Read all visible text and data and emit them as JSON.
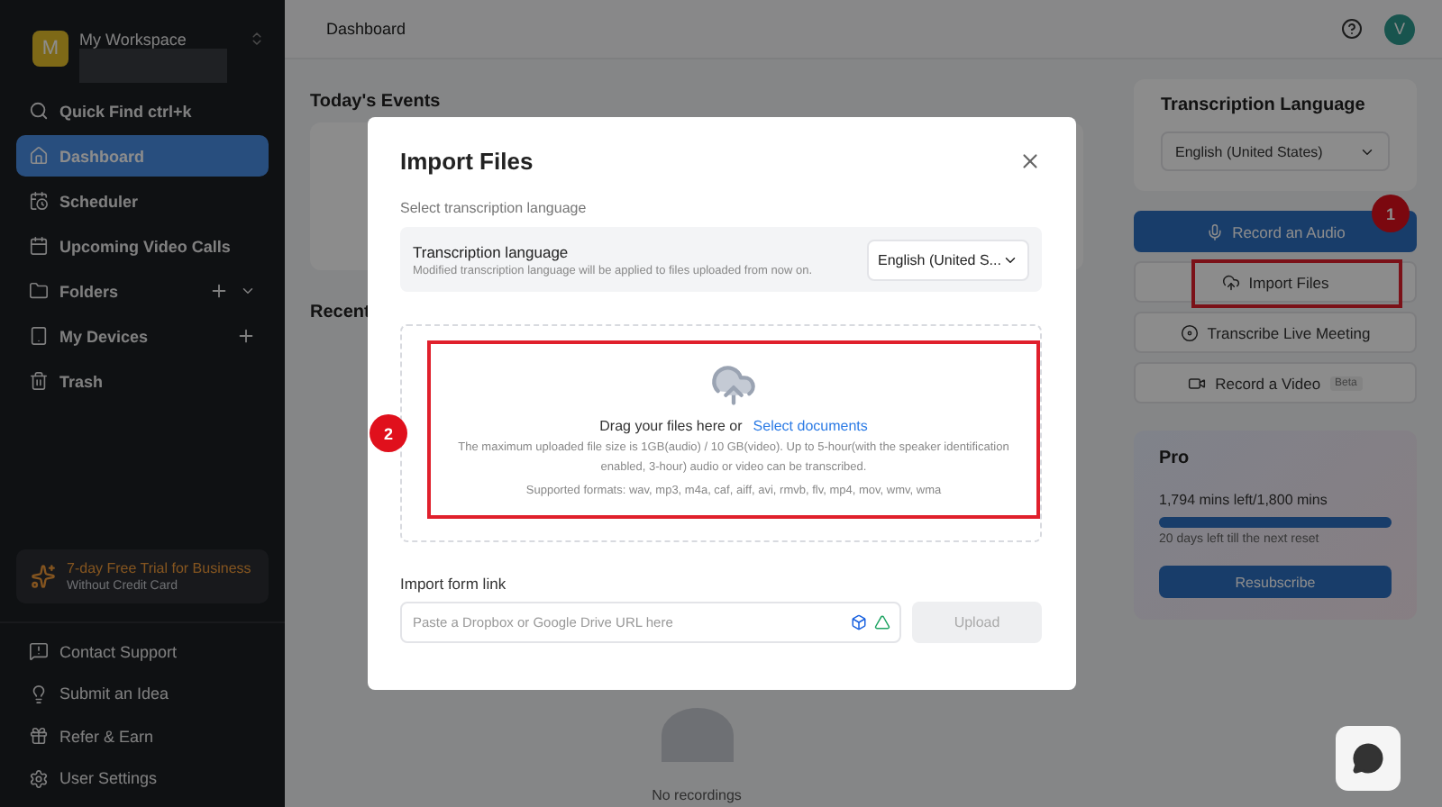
{
  "sidebar": {
    "workspace": {
      "initial": "M",
      "name": "My Workspace"
    },
    "quick_find": "Quick Find ctrl+k",
    "items": [
      {
        "kind": "home",
        "label": "Dashboard",
        "selected": true,
        "has_add": false,
        "has_expand": false
      },
      {
        "kind": "scheduler",
        "label": "Scheduler",
        "selected": false,
        "has_add": false,
        "has_expand": false
      },
      {
        "kind": "calendar",
        "label": "Upcoming Video Calls",
        "selected": false,
        "has_add": false,
        "has_expand": false
      },
      {
        "kind": "folder",
        "label": "Folders",
        "selected": false,
        "has_add": true,
        "has_expand": true
      },
      {
        "kind": "device",
        "label": "My Devices",
        "selected": false,
        "has_add": true,
        "has_expand": false
      },
      {
        "kind": "trash",
        "label": "Trash",
        "selected": false,
        "has_add": false,
        "has_expand": false
      }
    ],
    "promo": {
      "title": "7-day Free Trial for Business",
      "subtitle": "Without Credit Card"
    },
    "footer_items": [
      {
        "kind": "support",
        "label": "Contact Support"
      },
      {
        "kind": "idea",
        "label": "Submit an Idea"
      },
      {
        "kind": "gift",
        "label": "Refer & Earn"
      },
      {
        "kind": "settings",
        "label": "User Settings"
      }
    ]
  },
  "header": {
    "title": "Dashboard",
    "avatar": "V"
  },
  "main": {
    "events_title": "Today's Events",
    "recent_title": "Recent",
    "empty_text": "No recordings"
  },
  "right_panel": {
    "language_title": "Transcription Language",
    "language_value": "English (United States)",
    "actions": [
      {
        "kind": "mic",
        "label": "Record an Audio",
        "primary": true
      },
      {
        "kind": "upload",
        "label": "Import Files",
        "primary": false
      },
      {
        "kind": "meeting",
        "label": "Transcribe Live Meeting",
        "primary": false
      },
      {
        "kind": "video",
        "label": "Record a Video",
        "primary": false,
        "badge": "Beta"
      }
    ],
    "plan": {
      "name": "Pro",
      "usage": "1,794 mins left/1,800 mins",
      "level": 0.997,
      "reset": "20 days left till the next reset",
      "button": "Resubscribe"
    }
  },
  "modal": {
    "title": "Import Files",
    "section_label": "Select transcription language",
    "language_label": "Transcription language",
    "language_hint": "Modified transcription language will be applied to files uploaded from now on.",
    "language_value": "English (United S...",
    "drop_text": "Drag your files here or",
    "drop_link": "Select documents",
    "limits": "The maximum uploaded file size is 1GB(audio) / 10 GB(video). Up to 5-hour(with the speaker identification enabled, 3-hour) audio or video can be transcribed.",
    "formats": "Supported formats: wav, mp3, m4a, caf, aiff, avi, rmvb, flv, mp4, mov, wmv, wma",
    "link_label": "Import form link",
    "link_placeholder": "Paste a Dropbox or Google Drive URL here",
    "upload_button": "Upload",
    "upload_disabled": true
  },
  "annotations": [
    {
      "number": "1"
    },
    {
      "number": "2"
    }
  ]
}
